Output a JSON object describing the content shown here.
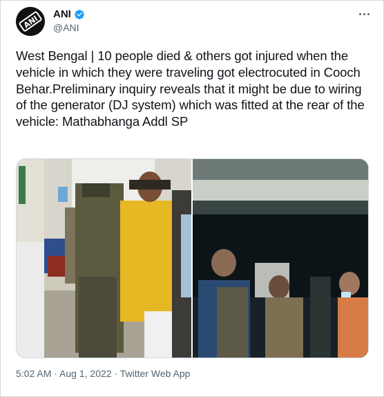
{
  "author": {
    "name": "ANI",
    "handle": "@ANI",
    "avatar_text": "ANI",
    "verified": true
  },
  "icons": {
    "verified": "verified-badge-icon",
    "more": "more-options-icon"
  },
  "tweet": {
    "text": "West Bengal | 10 people died & others got injured when the vehicle in which they were traveling got electrocuted in Cooch Behar.Preliminary inquiry reveals that it might be due to wiring of the generator (DJ system) which was fitted at the rear of the vehicle: Mathabhanga Addl SP"
  },
  "meta": {
    "time": "5:02 AM",
    "separator": " · ",
    "date": "Aug 1, 2022",
    "source": "Twitter Web App"
  },
  "colors": {
    "accent": "#1d9bf0",
    "text": "#0f1419",
    "secondary": "#536471",
    "border": "#cfd9de"
  }
}
